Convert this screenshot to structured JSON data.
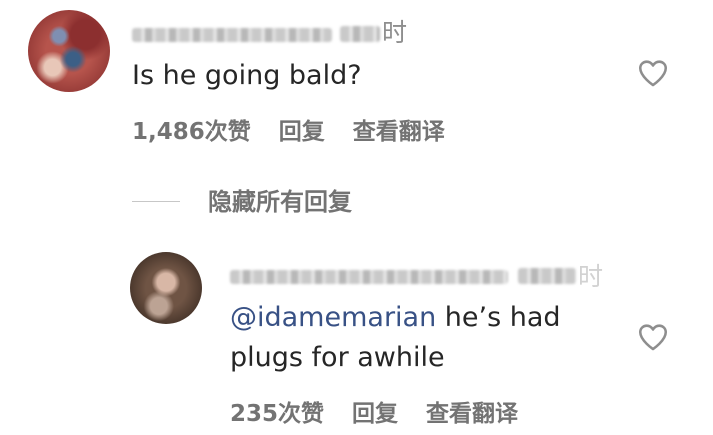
{
  "comments": [
    {
      "text": "Is he going bald?",
      "time_char": "时",
      "likes": "1,486次赞",
      "reply": "回复",
      "translate": "查看翻译"
    }
  ],
  "hide_replies": "隐藏所有回复",
  "reply_comment": {
    "mention": "@idamemarian",
    "text": " he’s had plugs for awhile",
    "time_char": "时",
    "likes": "235次赞",
    "reply": "回复",
    "translate": "查看翻译"
  },
  "icons": {
    "like": "heart-outline-icon"
  },
  "colors": {
    "mention": "#385185",
    "secondary": "#737373"
  }
}
